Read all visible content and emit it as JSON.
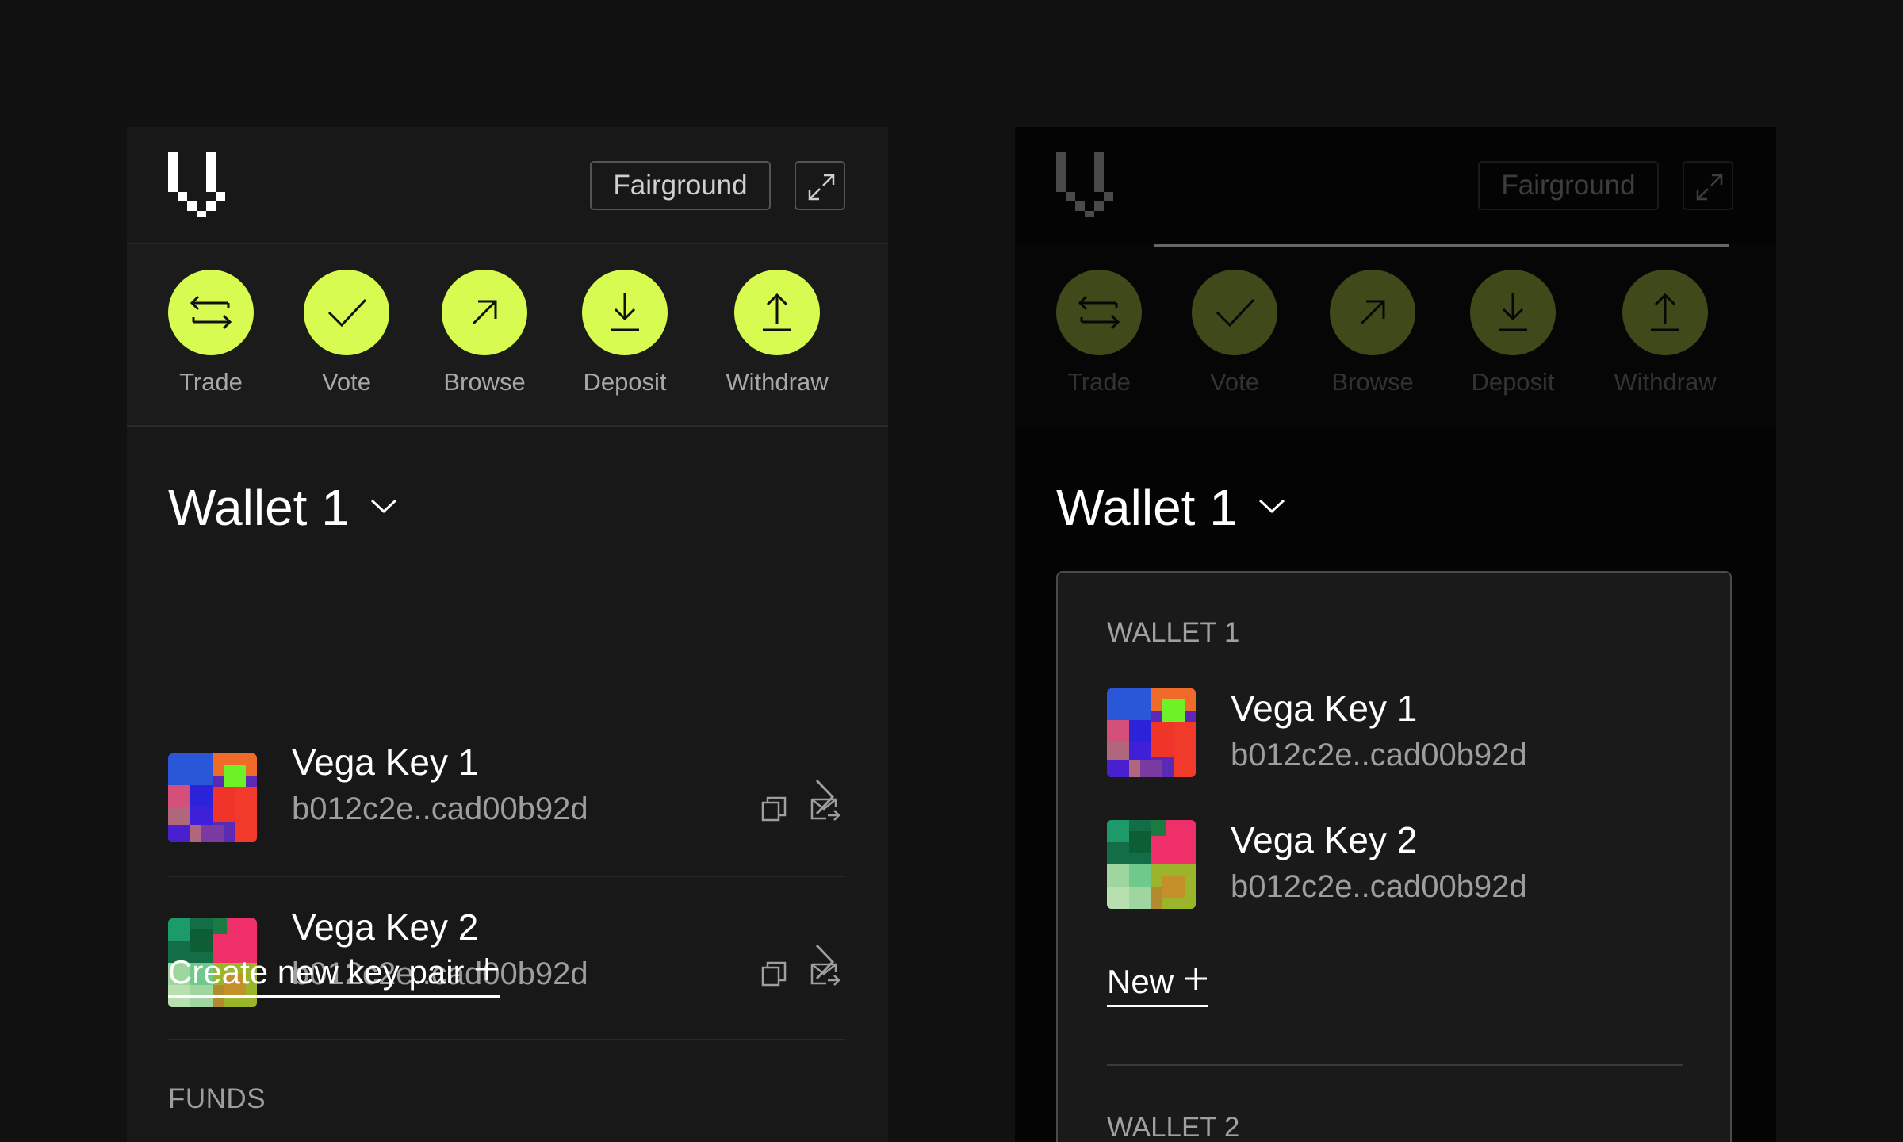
{
  "brand": {
    "accent": "#d7fb50",
    "background": "#111111",
    "panel": "#181818"
  },
  "header": {
    "logo_icon": "vega-logo-icon",
    "network_label": "Fairground",
    "expand_icon": "expand-arrows-icon"
  },
  "actions": [
    {
      "label": "Trade",
      "icon": "swap-arrows-icon"
    },
    {
      "label": "Vote",
      "icon": "checkmark-icon"
    },
    {
      "label": "Browse",
      "icon": "arrow-up-right-icon"
    },
    {
      "label": "Deposit",
      "icon": "arrow-down-to-line-icon"
    },
    {
      "label": "Withdraw",
      "icon": "arrow-up-from-line-icon"
    }
  ],
  "wallet": {
    "name": "Wallet 1",
    "keys": [
      {
        "name": "Vega Key 1",
        "pubkey": "b012c2e..cad00b92d"
      },
      {
        "name": "Vega Key 2",
        "pubkey": "b012c2e..cad00b92d"
      }
    ],
    "create_label": "Create new key pair",
    "funds_label": "FUNDS"
  },
  "dropdown": {
    "section1": "WALLET 1",
    "keys": [
      {
        "name": "Vega Key 1",
        "pubkey": "b012c2e..cad00b92d"
      },
      {
        "name": "Vega Key 2",
        "pubkey": "b012c2e..cad00b92d"
      }
    ],
    "new_label": "New",
    "section2": "WALLET 2"
  }
}
